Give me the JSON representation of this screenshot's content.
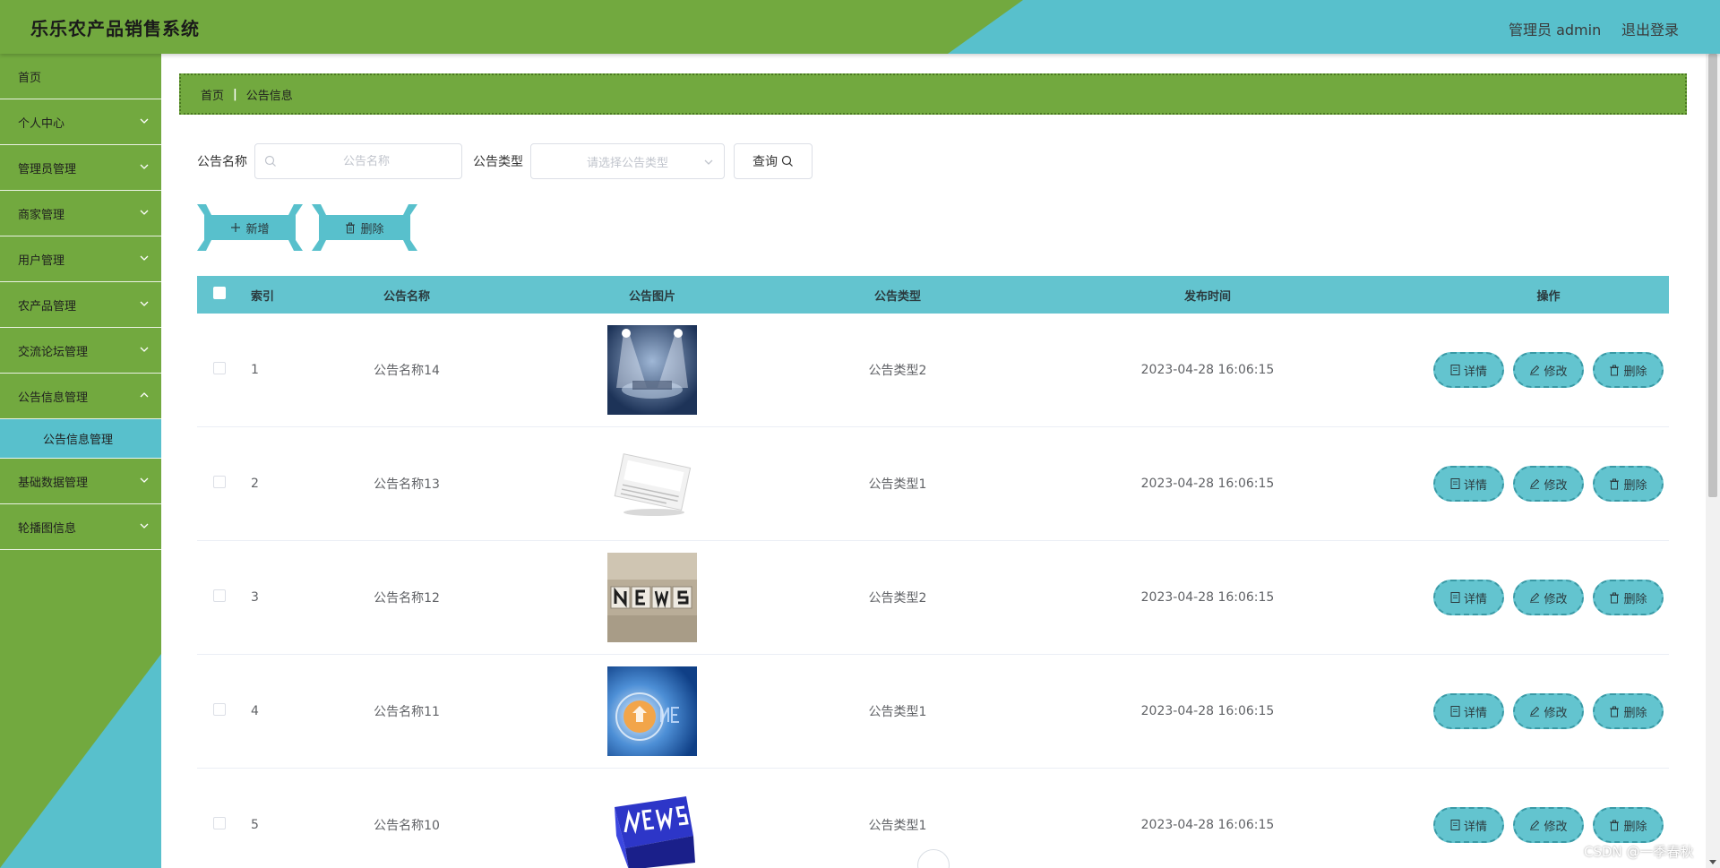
{
  "header": {
    "title": "乐乐农产品销售系统",
    "user_label": "管理员 admin",
    "logout_label": "退出登录"
  },
  "sidebar": {
    "items": [
      {
        "label": "首页",
        "expandable": false
      },
      {
        "label": "个人中心",
        "expandable": true
      },
      {
        "label": "管理员管理",
        "expandable": true
      },
      {
        "label": "商家管理",
        "expandable": true
      },
      {
        "label": "用户管理",
        "expandable": true
      },
      {
        "label": "农产品管理",
        "expandable": true
      },
      {
        "label": "交流论坛管理",
        "expandable": true
      },
      {
        "label": "公告信息管理",
        "expandable": true,
        "open": true
      },
      {
        "label": "公告信息管理",
        "sub": true,
        "active": true
      },
      {
        "label": "基础数据管理",
        "expandable": true
      },
      {
        "label": "轮播图信息",
        "expandable": true
      }
    ]
  },
  "breadcrumb": {
    "home": "首页",
    "current": "公告信息"
  },
  "search": {
    "name_label": "公告名称",
    "name_placeholder": "公告名称",
    "type_label": "公告类型",
    "type_placeholder": "请选择公告类型",
    "query_label": "查询"
  },
  "actions": {
    "add_label": "新增",
    "delete_label": "删除"
  },
  "table": {
    "headers": {
      "index": "索引",
      "name": "公告名称",
      "image": "公告图片",
      "type": "公告类型",
      "time": "发布时间",
      "ops": "操作"
    },
    "ops_labels": {
      "detail": "详情",
      "edit": "修改",
      "delete": "删除"
    },
    "rows": [
      {
        "index": "1",
        "name": "公告名称14",
        "image": "news-stage-image",
        "type": "公告类型2",
        "time": "2023-04-28 16:06:15"
      },
      {
        "index": "2",
        "name": "公告名称13",
        "image": "newspaper-image",
        "type": "公告类型1",
        "time": "2023-04-28 16:06:15"
      },
      {
        "index": "3",
        "name": "公告名称12",
        "image": "news-blocks-image",
        "type": "公告类型2",
        "time": "2023-04-28 16:06:15"
      },
      {
        "index": "4",
        "name": "公告名称11",
        "image": "news-globe-image",
        "type": "公告类型1",
        "time": "2023-04-28 16:06:15"
      },
      {
        "index": "5",
        "name": "公告名称10",
        "image": "news-key-image",
        "type": "公告类型1",
        "time": "2023-04-28 16:06:15"
      }
    ]
  },
  "watermark": "CSDN @一季春秋",
  "colors": {
    "green": "#72a93f",
    "teal": "#58c0cc",
    "table_header": "#63c4cf"
  }
}
